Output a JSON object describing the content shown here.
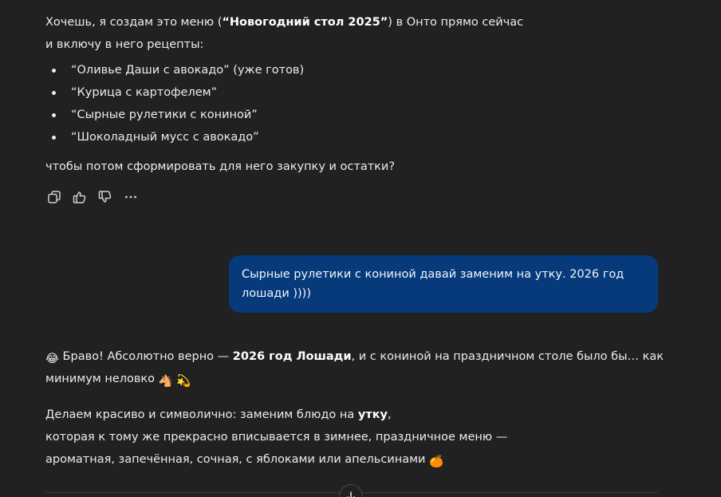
{
  "assistant_message_1": {
    "intro_line1_before": "Хочешь, я создам это меню (",
    "intro_line1_bold": "“Новогодний стол 2025”",
    "intro_line1_after": ") в Онто прямо сейчас",
    "intro_line2": "и включу в него рецепты:",
    "recipes": [
      "“Оливье Даши с авокадо” (уже готов)",
      "“Курица с картофелем”",
      "“Сырные рулетики с кониной”",
      "“Шоколадный мусс с авокадо”"
    ],
    "outro": "чтобы потом сформировать для него закупку и остатки?"
  },
  "message_actions": {
    "icons": [
      "copy-icon",
      "thumbs-up-icon",
      "thumbs-down-icon",
      "more-icon"
    ]
  },
  "user_message": {
    "line1": "Сырные рулетики с кониной давай заменим на утку. 2026 год",
    "line2": "лошади ))))"
  },
  "assistant_message_2": {
    "p1_emoji": "😂",
    "p1_before": " Браво! Абсолютно верно — ",
    "p1_bold": "2026 год Лошади",
    "p1_after": ", и с кониной на праздничном столе было бы… как",
    "p1_line2": "минимум неловко ",
    "p1_line2_emojis": "🐴 💫",
    "p2_line1_before": "Делаем красиво и символично: заменим блюдо на ",
    "p2_line1_bold": "утку",
    "p2_line1_after": ",",
    "p2_line2": "которая к тому же прекрасно вписывается в зимнее, праздничное меню —",
    "p2_line3": "ароматная, запечённая, сочная, с яблоками или апельсинами ",
    "p2_line3_emoji": "🍊"
  },
  "colors": {
    "background": "#212121",
    "text": "#ececec",
    "user_bubble": "#063a7b"
  }
}
